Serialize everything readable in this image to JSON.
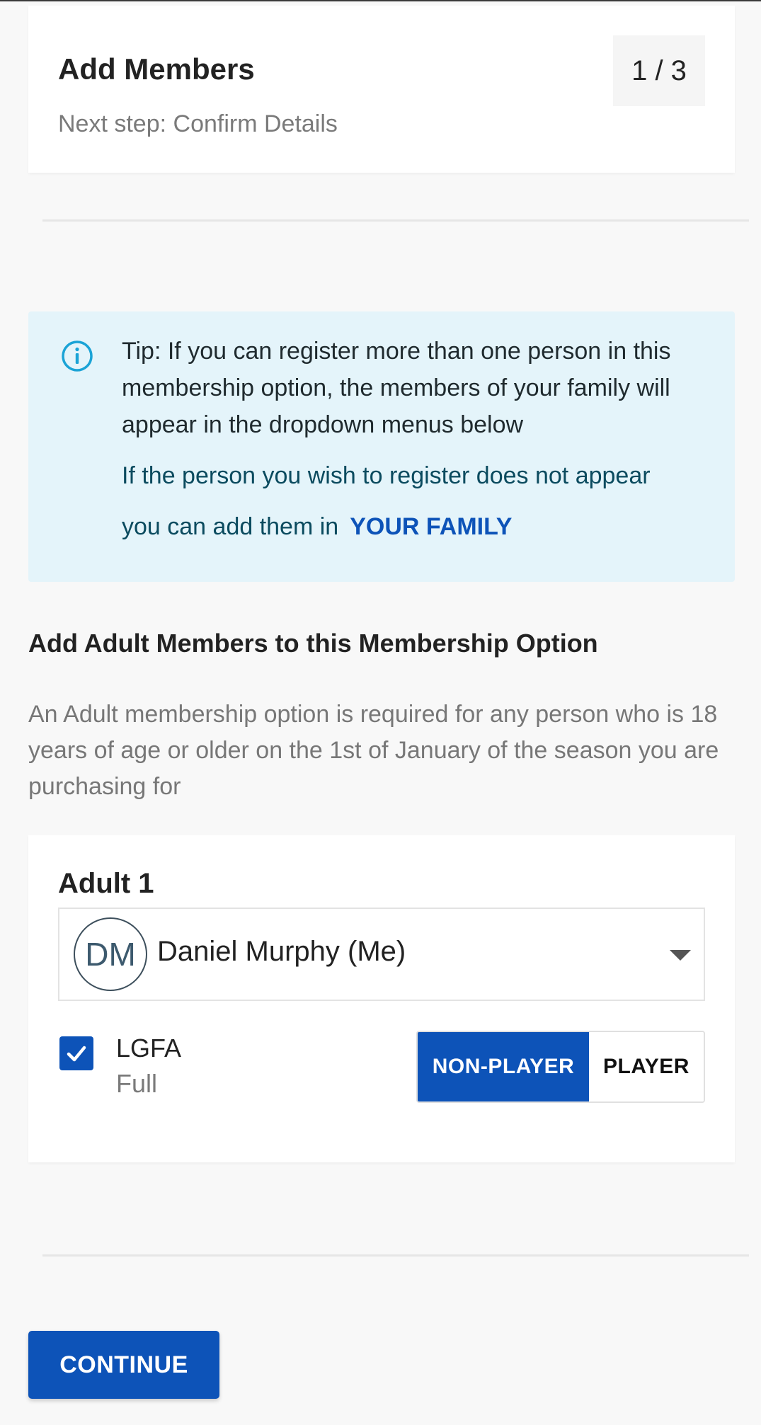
{
  "header": {
    "title": "Add Members",
    "next_step": "Next step: Confirm Details",
    "step_counter": "1 / 3"
  },
  "tip": {
    "icon": "info-icon",
    "text": "Tip: If you can register more than one person in this membership option, the members of your family will appear in the dropdown menus below",
    "sub_text": "If the person you wish to register does not appear you can add them in",
    "link_label": "YOUR FAMILY"
  },
  "section": {
    "heading": "Add Adult Members to this Membership Option",
    "description": "An Adult membership option is required for any person who is 18 years of age or older on the 1st of January of the season you are purchasing for"
  },
  "adult": {
    "label": "Adult 1",
    "select": {
      "avatar_initials": "DM",
      "selected_value": "Daniel Murphy (Me)"
    },
    "membership": {
      "checked": true,
      "org": "LGFA",
      "type": "Full"
    },
    "role_toggle": {
      "options": [
        "NON-PLAYER",
        "PLAYER"
      ],
      "selected": "NON-PLAYER"
    }
  },
  "footer": {
    "continue_label": "CONTINUE"
  },
  "colors": {
    "accent": "#0d53b8",
    "tip_background": "#e4f4fa",
    "info_icon": "#1aa3d6"
  }
}
